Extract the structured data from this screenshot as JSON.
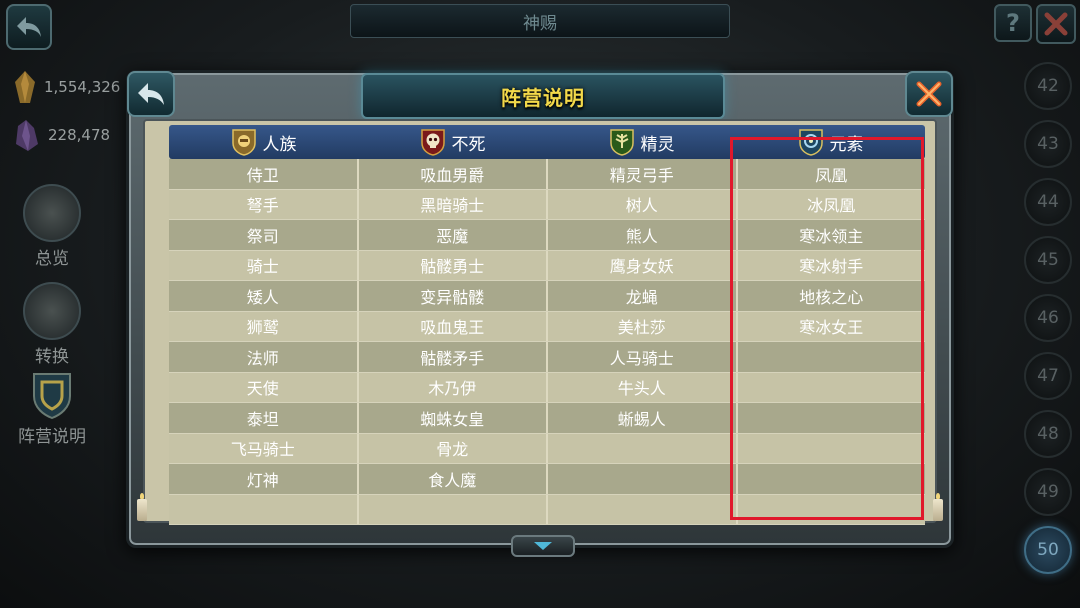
{
  "top": {
    "title": "神赐",
    "help_label": "?"
  },
  "resources": {
    "gold": "1,554,326",
    "crystal": "228,478"
  },
  "side_nav": [
    {
      "label": "总览"
    },
    {
      "label": "转换"
    },
    {
      "label": "阵营说明"
    }
  ],
  "levels": [
    "42",
    "43",
    "44",
    "45",
    "46",
    "47",
    "48",
    "49",
    "50"
  ],
  "active_level": "50",
  "dialog": {
    "title": "阵营说明"
  },
  "table": {
    "headers": [
      {
        "label": "人族",
        "icon": "human-faction-icon"
      },
      {
        "label": "不死",
        "icon": "undead-faction-icon"
      },
      {
        "label": "精灵",
        "icon": "elf-faction-icon"
      },
      {
        "label": "元素",
        "icon": "element-faction-icon"
      }
    ],
    "rows": [
      [
        "侍卫",
        "吸血男爵",
        "精灵弓手",
        "凤凰"
      ],
      [
        "弩手",
        "黑暗骑士",
        "树人",
        "冰凤凰"
      ],
      [
        "祭司",
        "恶魔",
        "熊人",
        "寒冰领主"
      ],
      [
        "骑士",
        "骷髅勇士",
        "鹰身女妖",
        "寒冰射手"
      ],
      [
        "矮人",
        "变异骷髅",
        "龙蝇",
        "地核之心"
      ],
      [
        "狮鹫",
        "吸血鬼王",
        "美杜莎",
        "寒冰女王"
      ],
      [
        "法师",
        "骷髅矛手",
        "人马骑士",
        ""
      ],
      [
        "天使",
        "木乃伊",
        "牛头人",
        ""
      ],
      [
        "泰坦",
        "蜘蛛女皇",
        "蜥蜴人",
        ""
      ],
      [
        "飞马骑士",
        "骨龙",
        "",
        ""
      ],
      [
        "灯神",
        "食人魔",
        "",
        ""
      ],
      [
        "",
        "",
        "",
        ""
      ]
    ]
  },
  "colors": {
    "title_gold": "#f3d94a",
    "header_blue": "#2c4a78",
    "highlight_red": "#e0182b"
  }
}
